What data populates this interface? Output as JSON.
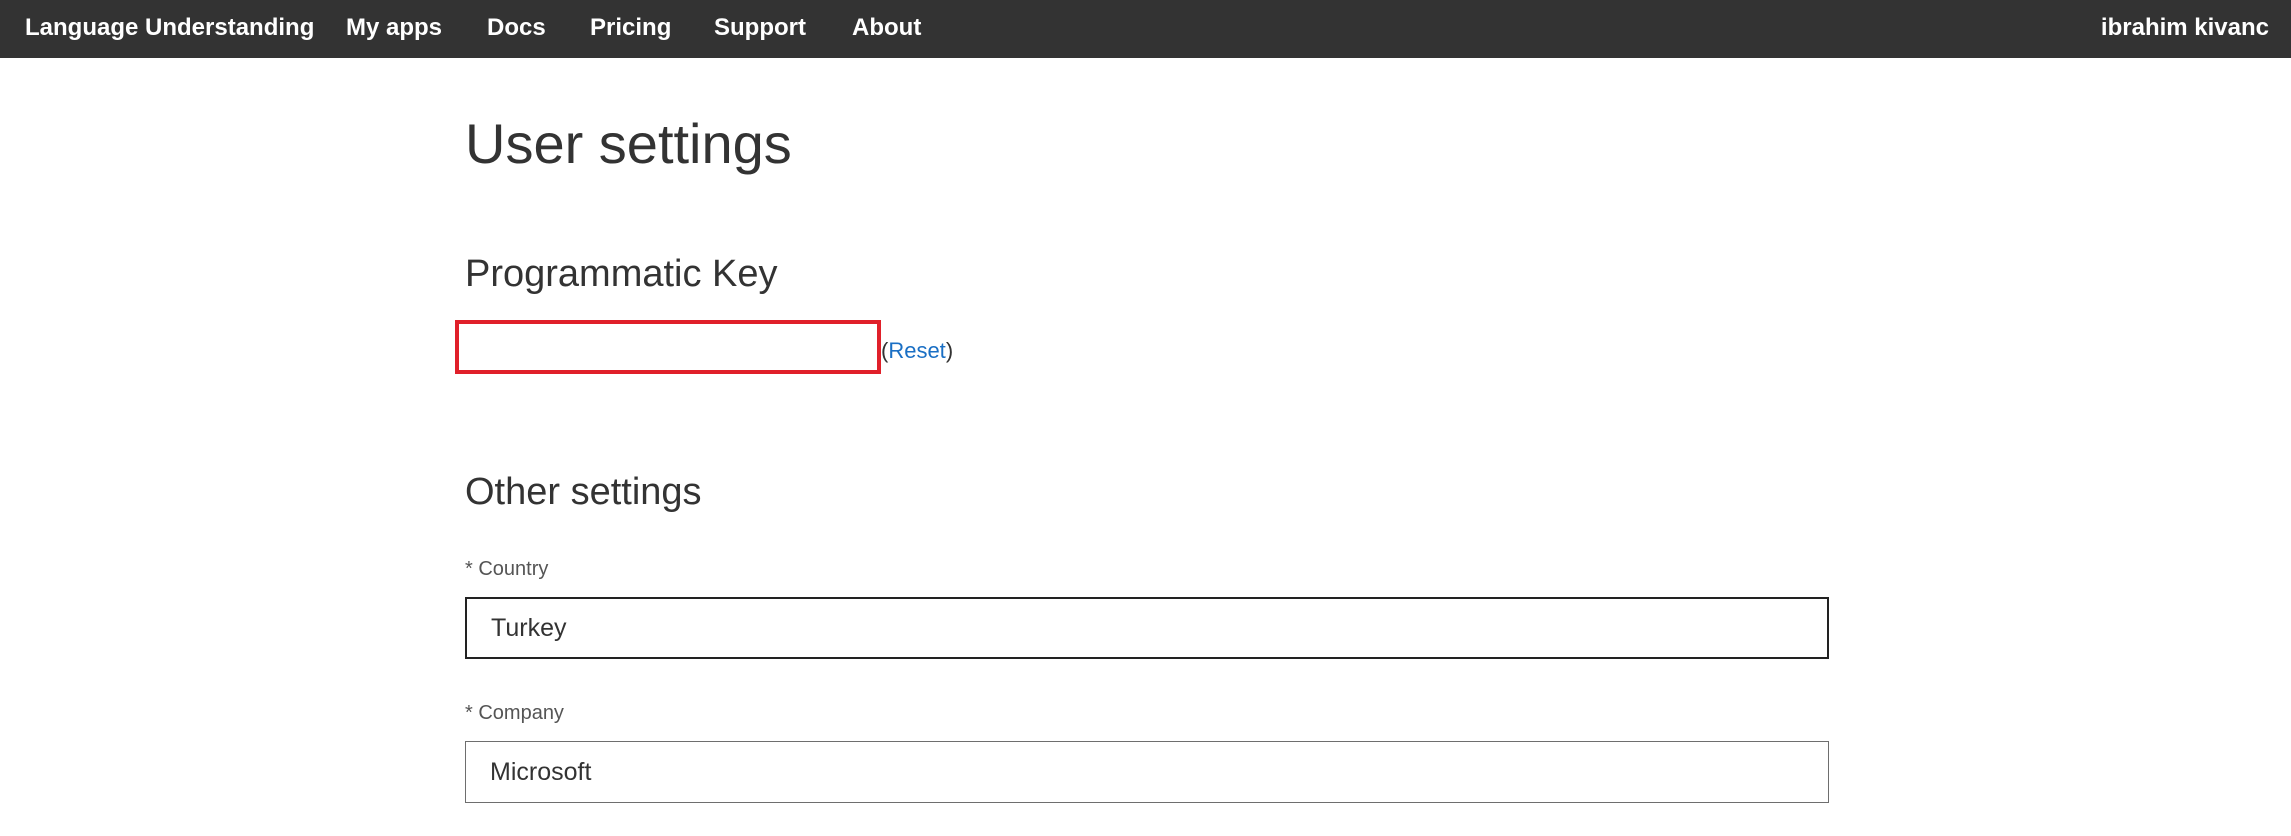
{
  "nav": {
    "brand": "Language Understanding",
    "links": [
      "My apps",
      "Docs",
      "Pricing",
      "Support",
      "About"
    ],
    "user": "ibrahim kivanc"
  },
  "page": {
    "title": "User settings"
  },
  "programmatic_key": {
    "heading": "Programmatic Key",
    "value": "",
    "reset_open": "(",
    "reset_label": "Reset",
    "reset_close": ")"
  },
  "other_settings": {
    "heading": "Other settings",
    "country": {
      "label": "* Country",
      "value": "Turkey"
    },
    "company": {
      "label": "* Company",
      "value": "Microsoft"
    }
  },
  "colors": {
    "topbar": "#333333",
    "link": "#1a6fc4",
    "highlight_box": "#e0202a"
  }
}
